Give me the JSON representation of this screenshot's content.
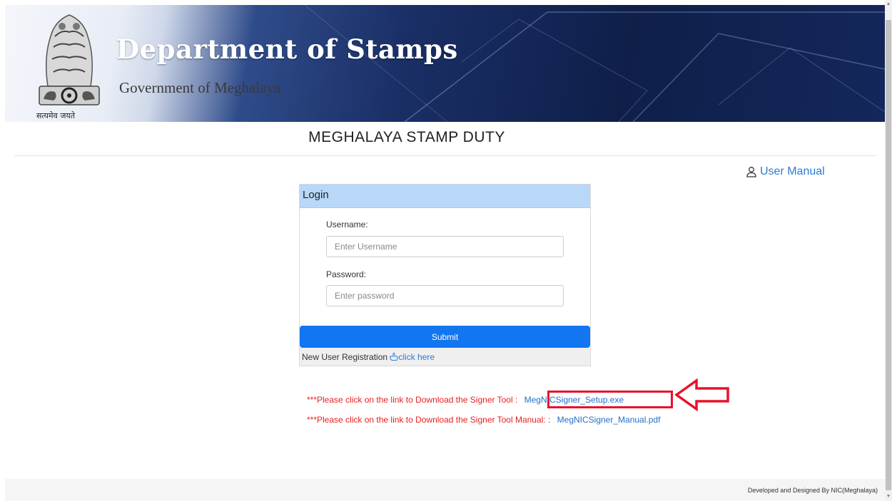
{
  "banner": {
    "title": "Department of Stamps",
    "subtitle": "Government of Meghalaya",
    "emblem_caption": "सत्यमेव जयते",
    "emblem_icon": "national-emblem-icon"
  },
  "page_heading": "MEGHALAYA STAMP DUTY",
  "user_manual": {
    "label": "User Manual",
    "icon": "user-icon"
  },
  "login": {
    "header": "Login",
    "username_label": "Username:",
    "username_placeholder": "Enter Username",
    "password_label": "Password:",
    "password_placeholder": "Enter password",
    "submit_label": "Submit",
    "registration_text": "New User Registration",
    "registration_link": "click here",
    "registration_icon": "hand-pointer-icon"
  },
  "downloads": {
    "signer_tool_text": "***Please click on the link to Download the Signer Tool :",
    "signer_tool_link": "MegNICSigner_Setup.exe",
    "signer_manual_text": "***Please click on the link to Download the Signer Tool Manual: :",
    "signer_manual_link": "MegNICSigner_Manual.pdf"
  },
  "footer": {
    "text": "Developed and Designed By NIC(Meghalaya)"
  },
  "colors": {
    "banner_dark": "#0f1f4a",
    "card_header": "#b8d7f9",
    "submit": "#1176f0",
    "link": "#2b7bd4",
    "warning_text": "#e82020",
    "highlight": "#e8122a"
  }
}
